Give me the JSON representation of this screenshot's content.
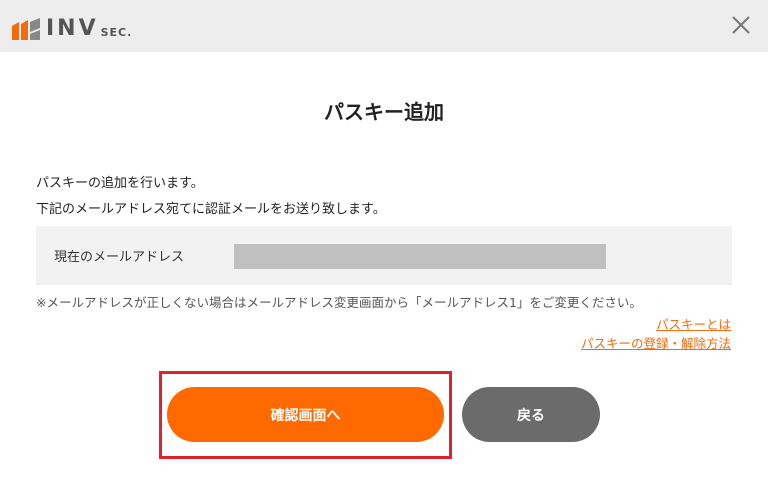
{
  "header": {
    "logo_main": "INV",
    "logo_sub": "SEC.",
    "close_icon": "close-icon"
  },
  "dialog": {
    "title": "パスキー追加",
    "description_line1": "パスキーの追加を行います。",
    "description_line2": "下記のメールアドレス宛てに認証メールをお送り致します。",
    "email": {
      "label": "現在のメールアドレス",
      "value": ""
    },
    "note": "※メールアドレスが正しくない場合はメールアドレス変更画面から「メールアドレス1」をご変更ください。",
    "links": {
      "what_is_passkey": "パスキーとは",
      "register_remove": "パスキーの登録・解除方法"
    },
    "buttons": {
      "confirm": "確認画面へ",
      "back": "戻る"
    }
  },
  "colors": {
    "accent": "#ff6a00",
    "link": "#f26b0f",
    "back_button": "#6b6b6b",
    "highlight": "#e0222c",
    "header_bg": "#ededed"
  }
}
